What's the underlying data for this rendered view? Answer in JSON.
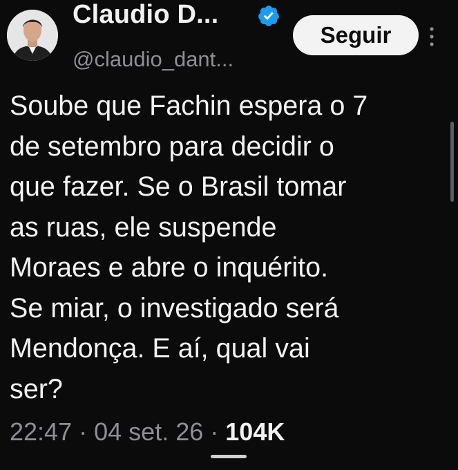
{
  "header": {
    "display_name": "Claudio D...",
    "handle": "@claudio_dant...",
    "follow_label": "Seguir"
  },
  "icons": {
    "avatar": "profile-photo",
    "verified": "verified-badge-icon",
    "more": "more-options-vertical-icon"
  },
  "tweet": {
    "text": "Soube que Fachin espera o 7\nde setembro para decidir o\nque fazer. Se o Brasil tomar\nas ruas, ele suspende\nMoraes e abre o inquérito.\nSe miar, o investigado será\nMendonça. E aí, qual vai\nser?"
  },
  "meta": {
    "time": "22:47",
    "separator": "·",
    "date": "04 set. 26",
    "views": "104K"
  },
  "colors": {
    "background": "#0b0b0c",
    "text": "#f2f2f2",
    "muted": "#8c8f93",
    "verified": "#1d9bf0",
    "button_bg": "#f3f3f3"
  }
}
